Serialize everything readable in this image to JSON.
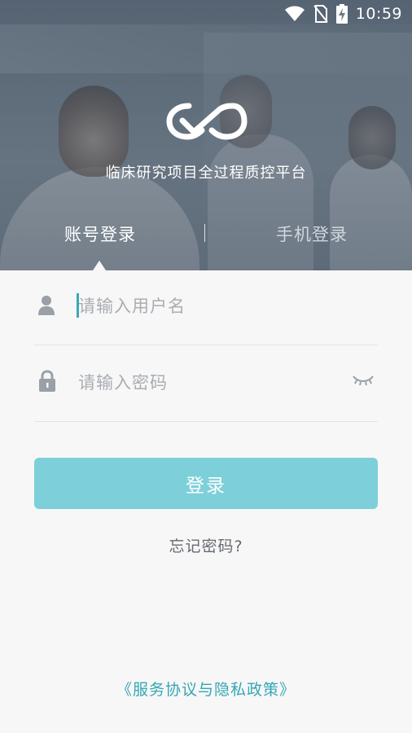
{
  "status_bar": {
    "time": "10:59",
    "icons": [
      "wifi-icon",
      "no-sim-icon",
      "battery-charging-icon"
    ]
  },
  "header": {
    "app_title": "临床研究项目全过程质控平台",
    "logo": "infinity-check-logo"
  },
  "tabs": [
    {
      "label": "账号登录",
      "active": true
    },
    {
      "label": "手机登录",
      "active": false
    }
  ],
  "form": {
    "username": {
      "value": "",
      "placeholder": "请输入用户名",
      "icon": "user-icon"
    },
    "password": {
      "value": "",
      "placeholder": "请输入密码",
      "icon": "lock-icon",
      "toggle_icon": "eye-closed-icon"
    },
    "login_label": "登录",
    "forgot_label": "忘记密码?"
  },
  "footer": {
    "policy_link": "《服务协议与隐私政策》"
  },
  "colors": {
    "accent": "#35a7b4",
    "button": "#7dd0d9",
    "background": "#f7f7f7"
  }
}
